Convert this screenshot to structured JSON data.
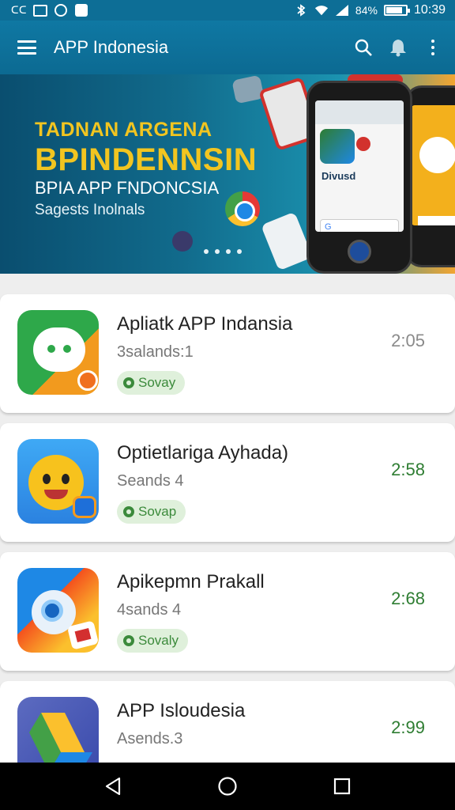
{
  "status_bar": {
    "left_text": "ᑕᑕ",
    "battery_text": "84%",
    "battery_level": 0.84,
    "time": "10:39"
  },
  "app_bar": {
    "title": "APP Indonesia",
    "icons": [
      "menu-icon",
      "search-icon",
      "bell-icon",
      "more-vert-icon"
    ]
  },
  "banner": {
    "line1": "TADNAN ARGENA",
    "line2": "BPINDENNSIN",
    "line3": "BPIA APP FNDONCSIA",
    "line4": "Sagests Inolnals",
    "phone_label": "Divusd",
    "search_hint": "G",
    "page_indicator_count": 4
  },
  "apps": [
    {
      "name": "Apliatk APP Indansia",
      "subtitle": "3salands:1",
      "badge": "Sovay",
      "time": "2:05",
      "icon": "chat-bubble-icon",
      "time_color": "#8a8a8a"
    },
    {
      "name": "Optietlariga Ayhada)",
      "subtitle": "Seands 4",
      "badge": "Sovap",
      "time": "2:58",
      "icon": "smiley-icon",
      "time_color": "#2e7d32"
    },
    {
      "name": "Apikepmn Prakall",
      "subtitle": "4sands 4",
      "badge": "Sovaly",
      "time": "2:68",
      "icon": "parrot-icon",
      "time_color": "#2e7d32"
    },
    {
      "name": "APP Isloudesia",
      "subtitle": "Asends.3",
      "badge": "",
      "time": "2:99",
      "icon": "drive-triangle-icon",
      "time_color": "#2e7d32"
    }
  ],
  "nav_bar": {
    "icons": [
      "back-icon",
      "home-icon",
      "recents-icon"
    ]
  }
}
